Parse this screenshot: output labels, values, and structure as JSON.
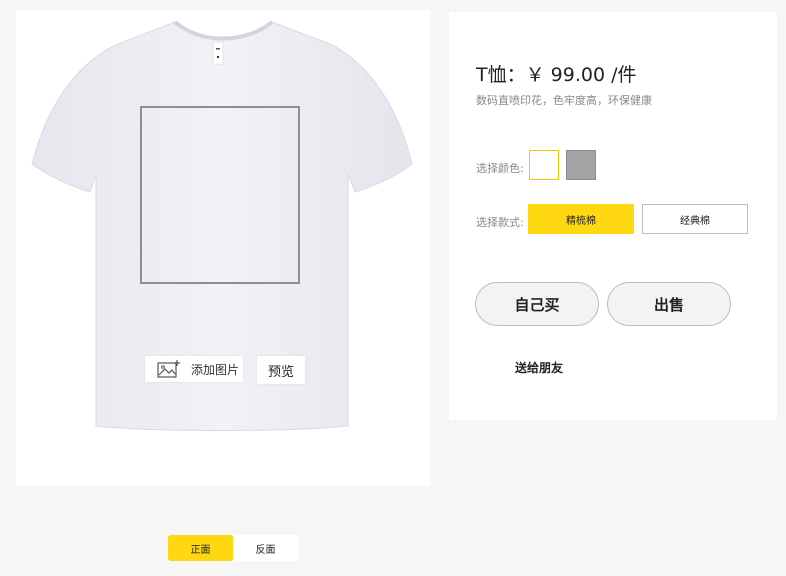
{
  "editor": {
    "add_image_label": "添加图片",
    "preview_label": "预览"
  },
  "side_toggle": {
    "front_label": "正面",
    "back_label": "反面",
    "selected": "正面"
  },
  "product": {
    "price_text": "T恤：￥ 99.00 /件",
    "description": "数码直喷印花，色牢度高，环保健康",
    "color_label": "选择颜色:",
    "colors": [
      {
        "name": "white",
        "hex": "#ffffff",
        "selected": true
      },
      {
        "name": "gray",
        "hex": "#a3a3a6",
        "selected": false
      }
    ],
    "style_label": "选择款式:",
    "styles": [
      {
        "label": "精梳棉",
        "selected": true
      },
      {
        "label": "经典棉",
        "selected": false
      }
    ],
    "buy_label": "自己买",
    "sell_label": "出售",
    "gift_label": "送给朋友"
  },
  "colors": {
    "accent": "#ffd811",
    "background": "#f6f6f6",
    "card": "#ffffff"
  }
}
